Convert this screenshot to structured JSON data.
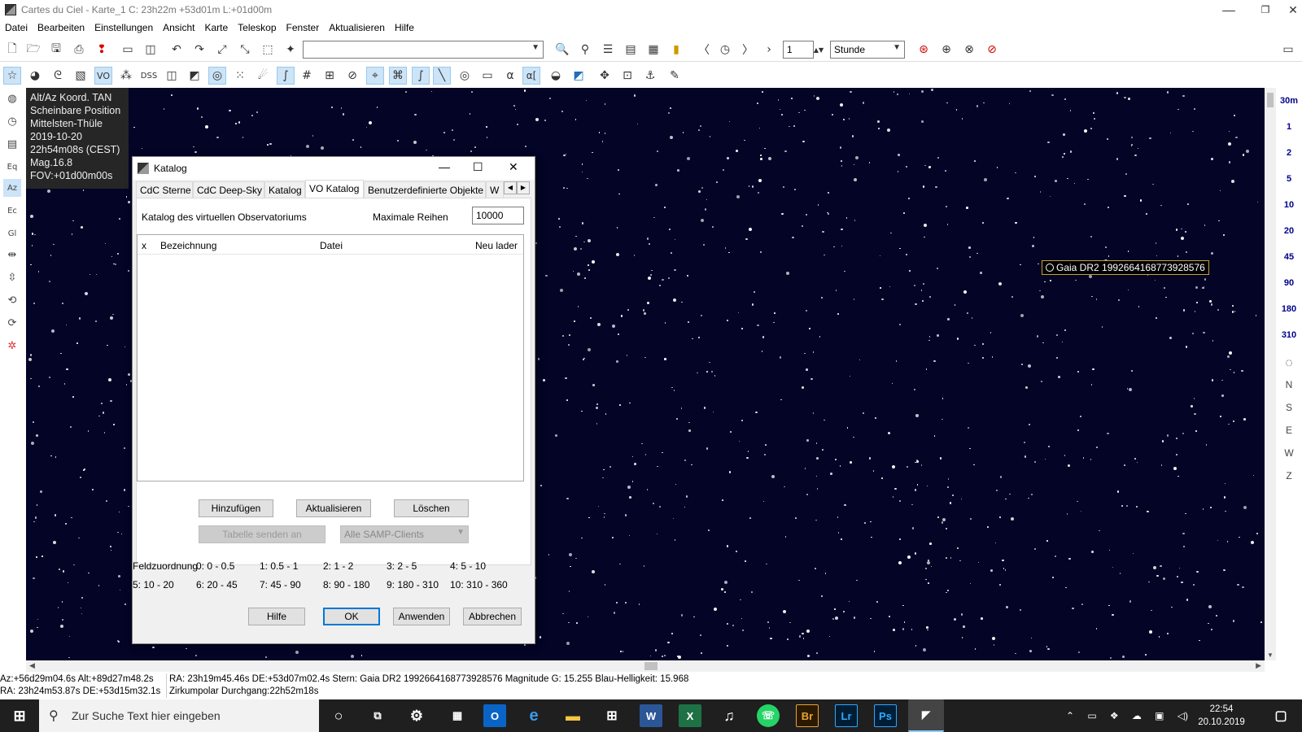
{
  "window": {
    "title": "Cartes du Ciel - Karte_1  C: 23h22m +53d01m L:+01d00m",
    "minimize": "—",
    "maximize": "❐",
    "close": "✕"
  },
  "menu": [
    "Datei",
    "Bearbeiten",
    "Einstellungen",
    "Ansicht",
    "Karte",
    "Teleskop",
    "Fenster",
    "Aktualisieren",
    "Hilfe"
  ],
  "toolbar": {
    "search_value": "",
    "step_value": "1",
    "unit_value": "Stunde"
  },
  "toolbar2": {
    "vo": "VO",
    "dss": "DSS",
    "alpha": "α",
    "alpha2": "α["
  },
  "info": {
    "line1": "Alt/Az Koord. TAN",
    "line2": "Scheinbare Position",
    "line3": "Mittelsten-Thüle",
    "line4": "2019-10-20",
    "line5": "22h54m08s (CEST)",
    "line6": "Mag.16.8",
    "line7": "FOV:+01d00m00s"
  },
  "object_label": "Gaia DR2 1992664168773928576",
  "fov_buttons": [
    "30m",
    "1",
    "2",
    "5",
    "10",
    "20",
    "45",
    "90",
    "180",
    "310"
  ],
  "orient_buttons": [
    "N",
    "S",
    "E",
    "W",
    "Z"
  ],
  "dialog": {
    "title": "Katalog",
    "tabs": [
      "CdC Sterne",
      "CdC Deep-Sky",
      "Katalog",
      "VO Katalog",
      "Benutzerdefinierte Objekte",
      "W"
    ],
    "vo_label": "Katalog des virtuellen Observatoriums",
    "max_rows_label": "Maximale Reihen",
    "max_rows_value": "10000",
    "columns": {
      "x": "x",
      "name": "Bezeichnung",
      "file": "Datei",
      "reload": "Neu laden"
    },
    "buttons": {
      "add": "Hinzufügen",
      "update": "Aktualisieren",
      "delete": "Löschen",
      "send": "Tabelle senden an",
      "samp": "Alle SAMP-Clients"
    },
    "field_label": "Feldzuordnung",
    "fields": [
      "0: 0 - 0.5",
      "1: 0.5 - 1",
      "2: 1 - 2",
      "3: 2 - 5",
      "4: 5 - 10",
      "5: 10 - 20",
      "6: 20 - 45",
      "7: 45 - 90",
      "8: 90 - 180",
      "9: 180 - 310",
      "10: 310 - 360"
    ],
    "footer": {
      "help": "Hilfe",
      "ok": "OK",
      "apply": "Anwenden",
      "cancel": "Abbrechen"
    }
  },
  "status": {
    "l1": "Az:+56d29m04.6s Alt:+89d27m48.2s",
    "l2": "RA: 23h24m53.87s DE:+53d15m32.1s",
    "r1": "RA: 23h19m45.46s DE:+53d07m02.4s  Stern: Gaia DR2 1992664168773928576  Magnitude G: 15.255  Blau-Helligkeit: 15.968",
    "r2": "Zirkumpolar   Durchgang:22h52m18s"
  },
  "taskbar": {
    "search_placeholder": "Zur Suche Text hier eingeben",
    "time": "22:54",
    "date": "20.10.2019",
    "apps": [
      "Br",
      "Lr",
      "Ps"
    ]
  }
}
